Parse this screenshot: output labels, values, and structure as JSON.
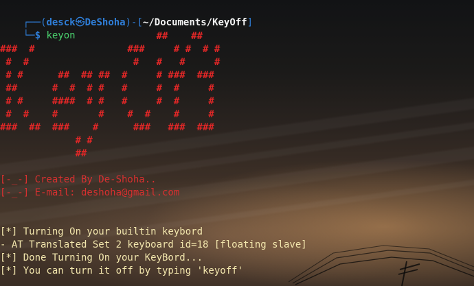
{
  "prompt": {
    "corner": "┌──",
    "open_paren": "(",
    "user": "desck",
    "skull": "㉿",
    "host": "DeShoha",
    "close_paren": ")-[",
    "path": "~/Documents/KeyOff",
    "close_bracket": "]",
    "prefix_second": "└─",
    "dollar": "$",
    "command": "keyon"
  },
  "banner": [
    "                           ##    ##",
    "###  #                ###     # #  # #",
    " #  #                  #   #   #     #",
    " # #      ##  ## ##  #     # ###  ###",
    " ##      #  #  # #   #     #  #     #",
    " # #     ####  # #   #     #  #     #",
    " #  #    #       #    #  #    #     #",
    "###  ##  ###    #      ###   ###  ###",
    "             # #",
    "             ##"
  ],
  "credits": [
    "[-_-] Created By De-Shoha..",
    "[-_-] E-mail: deshoha@gmail.com"
  ],
  "status": [
    "[*] Turning On your builtin keybord",
    "- AT Translated Set 2 keyboard id=18 [floating slave]",
    "[*] Done Turning On your KeyBord...",
    "[*] You can turn it off by typing 'keyoff'"
  ],
  "colors": {
    "prompt_blue": "#2f7ed8",
    "command_green": "#4bd26f",
    "banner_red": "#e32727",
    "credit_red": "#d83030",
    "status_text": "#f2e6ad"
  }
}
